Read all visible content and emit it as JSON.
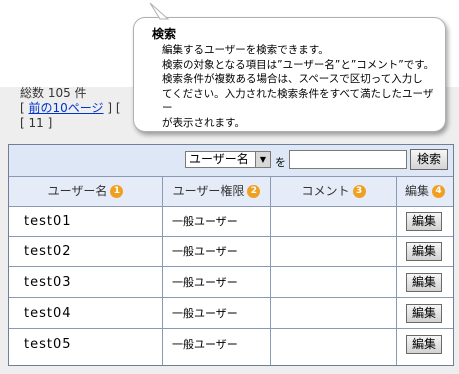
{
  "summary": {
    "total_label": "総数 105 件",
    "prev_link": "前の10ページ",
    "bracket_open": "[",
    "bracket_close": "]",
    "bracket_open2": "[",
    "current_page": "[ 11 ]"
  },
  "search": {
    "select_value": "ユーザー名",
    "particle": "を",
    "input_value": "",
    "button_label": "検索"
  },
  "columns": [
    {
      "label": "ユーザー名",
      "badge": "1"
    },
    {
      "label": "ユーザー権限",
      "badge": "2"
    },
    {
      "label": "コメント",
      "badge": "3"
    },
    {
      "label": "編集",
      "badge": "4"
    }
  ],
  "rows": [
    {
      "name": "test01",
      "role": "一般ユーザー",
      "comment": "",
      "edit": "編集"
    },
    {
      "name": "test02",
      "role": "一般ユーザー",
      "comment": "",
      "edit": "編集"
    },
    {
      "name": "test03",
      "role": "一般ユーザー",
      "comment": "",
      "edit": "編集"
    },
    {
      "name": "test04",
      "role": "一般ユーザー",
      "comment": "",
      "edit": "編集"
    },
    {
      "name": "test05",
      "role": "一般ユーザー",
      "comment": "",
      "edit": "編集"
    }
  ],
  "tooltip": {
    "title": "検索",
    "lines": [
      "編集するユーザーを検索できます。",
      "検索の対象となる項目は”ユーザー名”と”コメント”です。",
      "検索条件が複数ある場合は、スペースで区切って入力し",
      "てください。入力された検索条件をすべて満たしたユーザー",
      "が表示されます。"
    ]
  },
  "colors": {
    "accent_badge": "#f0a020",
    "header_bg": "#e6ecf7",
    "search_bg": "#dde7f5",
    "border": "#6f7f99"
  }
}
